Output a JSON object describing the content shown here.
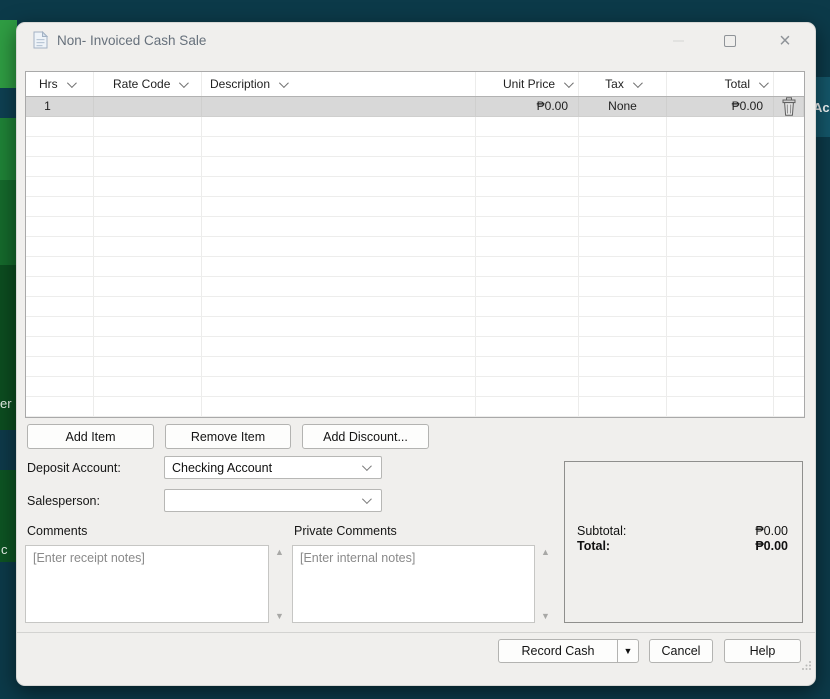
{
  "background": {
    "left_fragment_upper": "er",
    "left_fragment_lower": "c",
    "right_fragment": "Aco"
  },
  "window": {
    "title": "Non- Invoiced Cash Sale"
  },
  "table": {
    "columns": [
      {
        "key": "hrs",
        "label": "Hrs"
      },
      {
        "key": "rate_code",
        "label": "Rate Code"
      },
      {
        "key": "description",
        "label": "Description"
      },
      {
        "key": "unit_price",
        "label": "Unit Price"
      },
      {
        "key": "tax",
        "label": "Tax"
      },
      {
        "key": "total",
        "label": "Total"
      }
    ],
    "rows": [
      {
        "hrs": "1",
        "rate_code": "",
        "description": "",
        "unit_price": "₱0.00",
        "tax": "None",
        "total": "₱0.00"
      }
    ],
    "empty_row_count": 15
  },
  "item_actions": {
    "add_item": "Add Item",
    "remove_item": "Remove Item",
    "add_discount": "Add Discount..."
  },
  "form": {
    "deposit_account_label": "Deposit Account:",
    "deposit_account_value": "Checking Account",
    "salesperson_label": "Salesperson:",
    "salesperson_value": "",
    "comments_label": "Comments",
    "comments_placeholder": "[Enter receipt notes]",
    "private_comments_label": "Private Comments",
    "private_comments_placeholder": "[Enter internal notes]"
  },
  "totals": {
    "subtotal_label": "Subtotal:",
    "subtotal_value": "₱0.00",
    "total_label": "Total:",
    "total_value": "₱0.00"
  },
  "footer": {
    "record_cash_label": "Record Cash",
    "cancel_label": "Cancel",
    "help_label": "Help"
  },
  "colors": {
    "background_teal": "#0c3a49",
    "accent_green": "#2f9d43",
    "dialog_background": "#f0efed",
    "selected_row": "#d8d8d8"
  }
}
